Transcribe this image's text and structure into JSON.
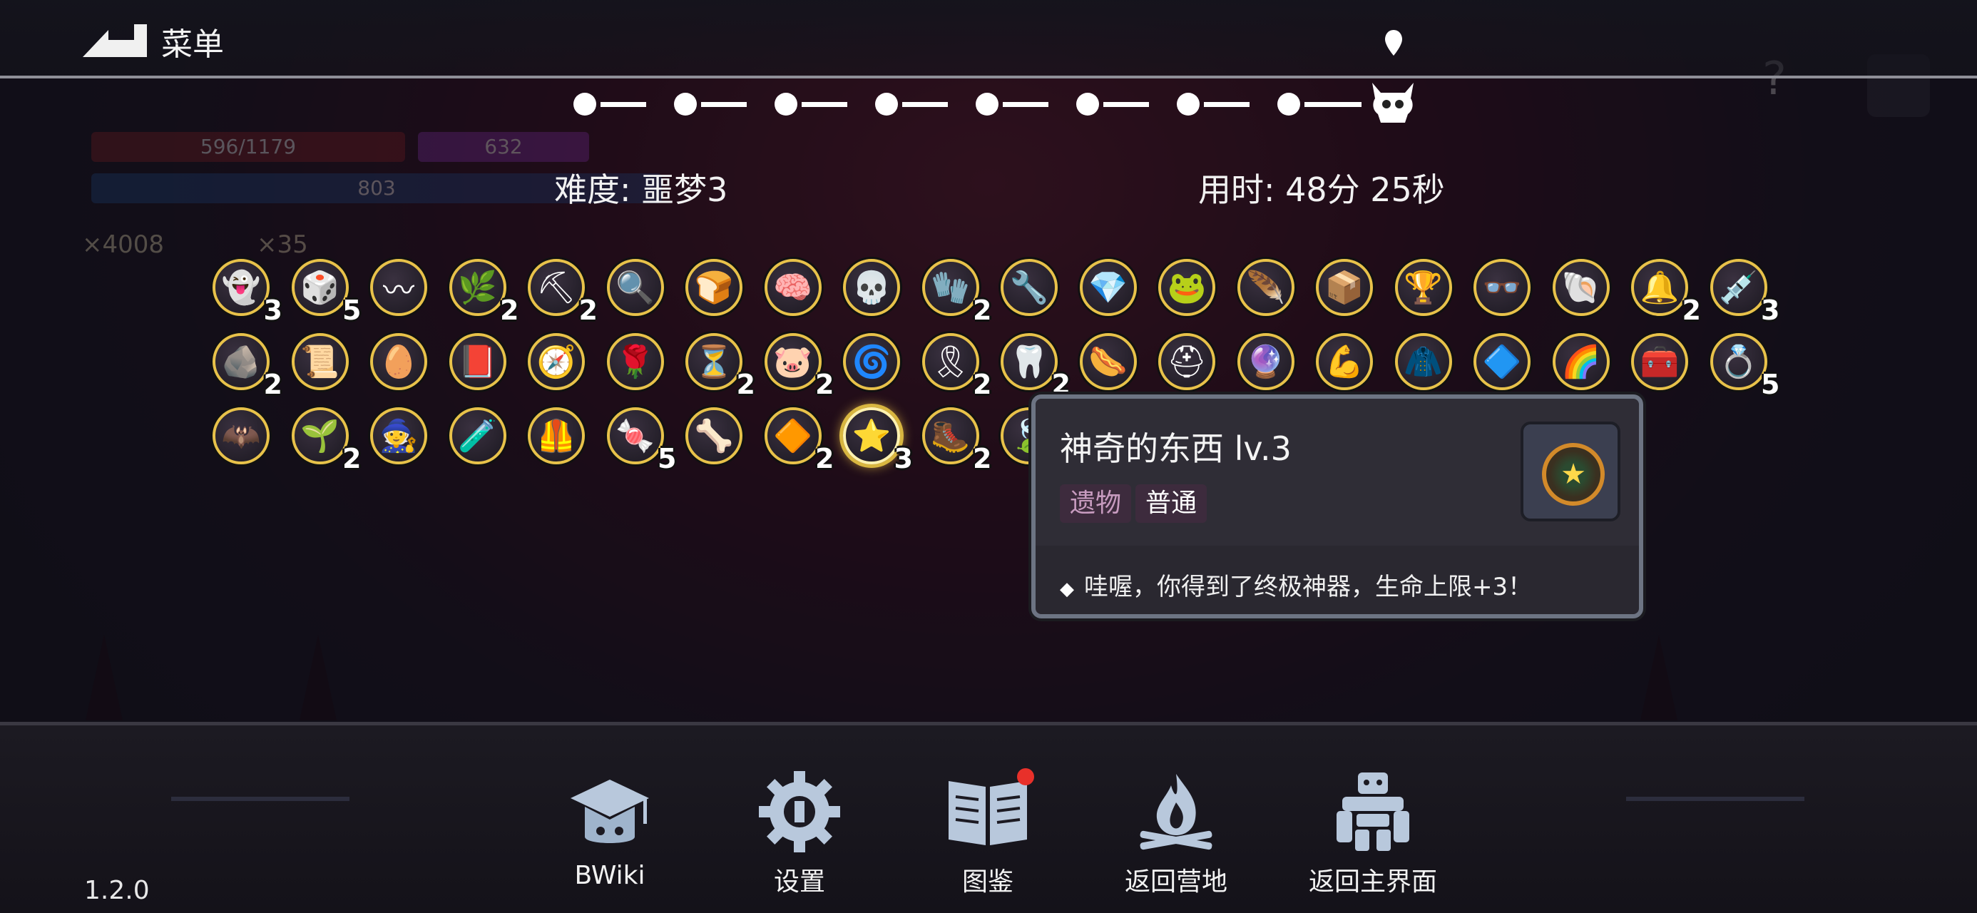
{
  "menu": {
    "title": "菜单"
  },
  "hud": {
    "hp": "596/1179",
    "shield": "632",
    "mana": "803",
    "gold": "×4008",
    "keys": "×35"
  },
  "run": {
    "difficulty": "难度: 噩梦3",
    "time": "用时: 48分 25秒",
    "nodes_completed": 8,
    "nodes_total": 9
  },
  "items": [
    {
      "icon": "ghost-crystal-icon",
      "glyph": "👻",
      "count": "3"
    },
    {
      "icon": "dice-icon",
      "glyph": "🎲",
      "count": "5"
    },
    {
      "icon": "bracelet-icon",
      "glyph": "〰",
      "count": ""
    },
    {
      "icon": "leaf-sprig-icon",
      "glyph": "🌿",
      "count": "2"
    },
    {
      "icon": "pickaxe-icon",
      "glyph": "⛏",
      "count": "2"
    },
    {
      "icon": "magnifier-icon",
      "glyph": "🔍",
      "count": ""
    },
    {
      "icon": "bread-icon",
      "glyph": "🍞",
      "count": ""
    },
    {
      "icon": "brain-icon",
      "glyph": "🧠",
      "count": ""
    },
    {
      "icon": "skull-stone-icon",
      "glyph": "💀",
      "count": ""
    },
    {
      "icon": "gauntlet-icon",
      "glyph": "🧤",
      "count": "2"
    },
    {
      "icon": "wrench-icon",
      "glyph": "🔧",
      "count": ""
    },
    {
      "icon": "gem-icon",
      "glyph": "💎",
      "count": ""
    },
    {
      "icon": "frog-icon",
      "glyph": "🐸",
      "count": ""
    },
    {
      "icon": "wing-icon",
      "glyph": "🪶",
      "count": ""
    },
    {
      "icon": "crate-icon",
      "glyph": "📦",
      "count": ""
    },
    {
      "icon": "goblet-icon",
      "glyph": "🏆",
      "count": ""
    },
    {
      "icon": "glasses-icon",
      "glyph": "👓",
      "count": ""
    },
    {
      "icon": "shell-icon",
      "glyph": "🐚",
      "count": ""
    },
    {
      "icon": "bell-icon",
      "glyph": "🔔",
      "count": "2"
    },
    {
      "icon": "syringe-icon",
      "glyph": "💉",
      "count": "3"
    },
    {
      "icon": "ore-icon",
      "glyph": "🪨",
      "count": "2"
    },
    {
      "icon": "scroll-icon",
      "glyph": "📜",
      "count": ""
    },
    {
      "icon": "egg-icon",
      "glyph": "🥚",
      "count": ""
    },
    {
      "icon": "spellbook-icon",
      "glyph": "📕",
      "count": ""
    },
    {
      "icon": "compass-icon",
      "glyph": "🧭",
      "count": ""
    },
    {
      "icon": "flower-icon",
      "glyph": "🌹",
      "count": ""
    },
    {
      "icon": "hourglass-icon",
      "glyph": "⏳",
      "count": "2"
    },
    {
      "icon": "pig-icon",
      "glyph": "🐷",
      "count": "2"
    },
    {
      "icon": "swirl-icon",
      "glyph": "🌀",
      "count": ""
    },
    {
      "icon": "belt-icon",
      "glyph": "🎗",
      "count": "2"
    },
    {
      "icon": "jaw-icon",
      "glyph": "🦷",
      "count": "2"
    },
    {
      "icon": "sausage-icon",
      "glyph": "🌭",
      "count": ""
    },
    {
      "icon": "helmet-icon",
      "glyph": "⛑",
      "count": ""
    },
    {
      "icon": "orb-crown-icon",
      "glyph": "🔮",
      "count": ""
    },
    {
      "icon": "arm-icon",
      "glyph": "💪",
      "count": ""
    },
    {
      "icon": "cloak-icon",
      "glyph": "🧥",
      "count": ""
    },
    {
      "icon": "crystal-icon",
      "glyph": "🔷",
      "count": ""
    },
    {
      "icon": "rainbow-scarf-icon",
      "glyph": "🌈",
      "count": ""
    },
    {
      "icon": "chest-icon",
      "glyph": "🧰",
      "count": ""
    },
    {
      "icon": "ring-icon",
      "glyph": "💍",
      "count": "5"
    },
    {
      "icon": "bat-icon",
      "glyph": "🦇",
      "count": ""
    },
    {
      "icon": "grass-icon",
      "glyph": "🌱",
      "count": "2"
    },
    {
      "icon": "dark-cloak-icon",
      "glyph": "🧙",
      "count": ""
    },
    {
      "icon": "potion-icon",
      "glyph": "🧪",
      "count": ""
    },
    {
      "icon": "armor-icon",
      "glyph": "🦺",
      "count": ""
    },
    {
      "icon": "candy-corn-icon",
      "glyph": "🍬",
      "count": "5"
    },
    {
      "icon": "claw-icon",
      "glyph": "🦴",
      "count": ""
    },
    {
      "icon": "cube-icon",
      "glyph": "🔶",
      "count": "2"
    },
    {
      "icon": "star-medal-icon",
      "glyph": "⭐",
      "count": "3"
    },
    {
      "icon": "boot-icon",
      "glyph": "🥾",
      "count": "2"
    },
    {
      "icon": "feather-icon",
      "glyph": "🍃",
      "count": ""
    }
  ],
  "tooltip": {
    "title": "神奇的东西 lv.3",
    "tag_type": "遗物",
    "tag_rarity": "普通",
    "description": "哇喔，你得到了终极神器，生命上限+3！",
    "icon": "star-medal-icon"
  },
  "nav": [
    {
      "label": "BWiki",
      "icon": "graduation-cap-icon",
      "name": "bwiki-button"
    },
    {
      "label": "设置",
      "icon": "gear-icon",
      "name": "settings-button"
    },
    {
      "label": "图鉴",
      "icon": "book-icon",
      "name": "codex-button"
    },
    {
      "label": "返回营地",
      "icon": "campfire-icon",
      "name": "return-camp-button"
    },
    {
      "label": "返回主界面",
      "icon": "golem-icon",
      "name": "return-main-button"
    }
  ],
  "version": "1.2.0",
  "colors": {
    "accent_gold": "#e8c24a",
    "tag_bg": "#3d2b3d",
    "notification": "#e8302a"
  }
}
